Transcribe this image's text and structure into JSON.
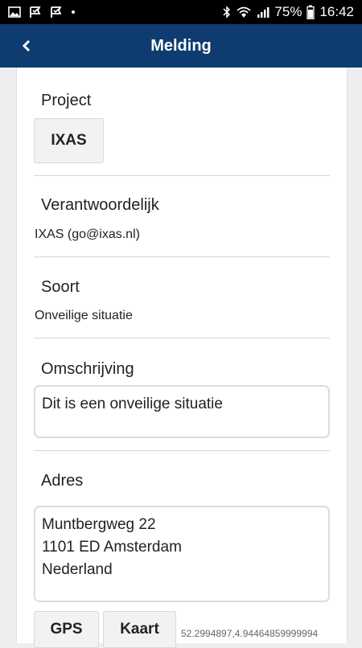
{
  "status_bar": {
    "battery": "75%",
    "time": "16:42",
    "left_icons": [
      "image-icon",
      "check-flag-icon",
      "check-flag-icon",
      "dot-icon"
    ],
    "right_icons": [
      "bluetooth-icon",
      "wifi-icon",
      "signal-icon",
      "battery-icon"
    ]
  },
  "app_bar": {
    "title": "Melding",
    "back_icon": "back-chevron-icon",
    "background": "#0e3b70"
  },
  "form": {
    "project": {
      "label": "Project",
      "button": "IXAS"
    },
    "responsible": {
      "label": "Verantwoordelijk",
      "value": "IXAS (go@ixas.nl)"
    },
    "type": {
      "label": "Soort",
      "value": "Onveilige situatie"
    },
    "description": {
      "label": "Omschrijving",
      "value": "Dit is een onveilige situatie"
    },
    "address": {
      "label": "Adres",
      "value": "Muntbergweg 22\n1101 ED Amsterdam\nNederland",
      "gps_button": "GPS",
      "map_button": "Kaart",
      "coordinates": "52.2994897,4.94464859999994"
    }
  }
}
